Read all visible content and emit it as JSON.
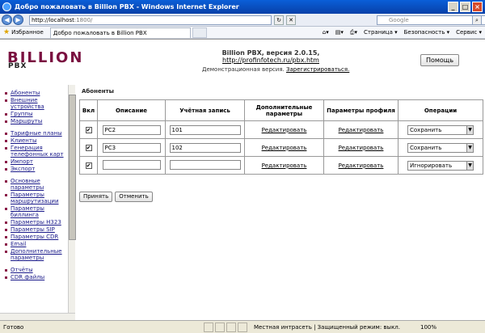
{
  "window": {
    "title": "Добро пожаловать в Billion PBX - Windows Internet Explorer"
  },
  "nav": {
    "address_domain": "http://localhost",
    "address_rest": ":1800/",
    "search_placeholder": "Google"
  },
  "favbar": {
    "favorites": "Избранное",
    "tab_title": "Добро пожаловать в Billion PBX",
    "tools": [
      "Страница ▾",
      "Безопасность ▾",
      "Сервис ▾"
    ]
  },
  "page": {
    "logo_top": "BILLION",
    "logo_bottom": "PBX",
    "header_text": "Billion PBX, версия 2.0.15, ",
    "header_link": "http://profinfotech.ru/pbx.htm",
    "demo_text": "Демонстрационная версия. ",
    "demo_link": "Зарегистрироваться.",
    "help_button": "Помощь"
  },
  "sidebar": {
    "items": [
      {
        "label": "Абоненты"
      },
      {
        "label": "Внешние устройства"
      },
      {
        "label": "Группы"
      },
      {
        "label": "Маршруты"
      },
      {
        "label": "Тарифные планы",
        "gap": true
      },
      {
        "label": "Клиенты"
      },
      {
        "label": "Генерация телефонных карт"
      },
      {
        "label": "Импорт"
      },
      {
        "label": "Экспорт"
      },
      {
        "label": "Основные параметры",
        "gap": true
      },
      {
        "label": "Параметры маршрутизации"
      },
      {
        "label": "Параметры биллинга"
      },
      {
        "label": "Параметры H323"
      },
      {
        "label": "Параметры SIP"
      },
      {
        "label": "Параметры CDR"
      },
      {
        "label": "Email"
      },
      {
        "label": "Дополнительные параметры"
      },
      {
        "label": "Отчёты",
        "gap": true
      },
      {
        "label": "CDR файлы"
      }
    ]
  },
  "main": {
    "section_title": "Абоненты",
    "headers": [
      "Вкл",
      "Описание",
      "Учётная запись",
      "Дополнительные параметры",
      "Параметры профиля",
      "Операции"
    ],
    "rows": [
      {
        "enabled": "✔",
        "description": "PC2",
        "account": "101",
        "extra": "Редактировать",
        "profile": "Редактировать",
        "operation": "Сохранить"
      },
      {
        "enabled": "✔",
        "description": "PC3",
        "account": "102",
        "extra": "Редактировать",
        "profile": "Редактировать",
        "operation": "Сохранить"
      },
      {
        "enabled": "✔",
        "description": "",
        "account": "",
        "extra": "Редактировать",
        "profile": "Редактировать",
        "operation": "Игнорировать"
      }
    ],
    "apply_button": "Принять",
    "cancel_button": "Отменить"
  },
  "status": {
    "left": "Готово",
    "zone": "Местная интрасеть | Защищенный режим: выкл.",
    "zoom": "100%"
  }
}
